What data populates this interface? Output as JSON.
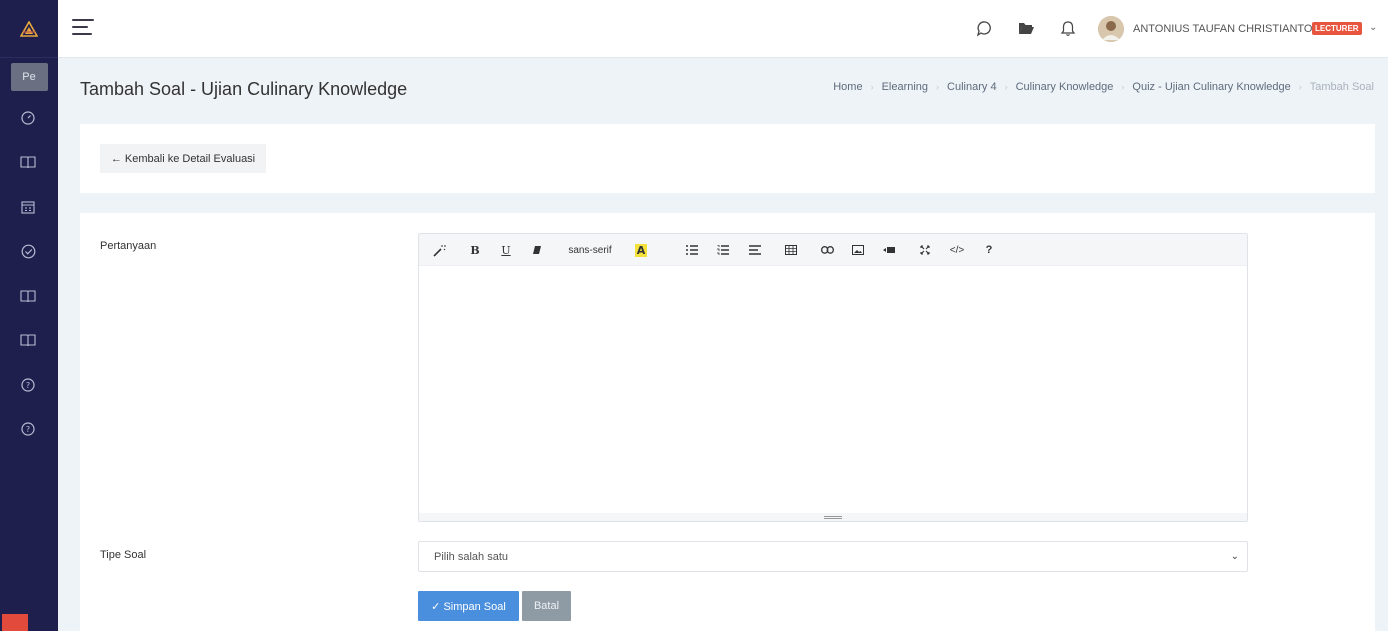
{
  "sidebar": {
    "logo_icon": "triangle-logo-icon",
    "pinned_label": "Pe",
    "items": [
      {
        "icon": "dashboard-gauge-icon"
      },
      {
        "icon": "book-icon"
      },
      {
        "icon": "calendar-icon"
      },
      {
        "icon": "check-circle-icon"
      },
      {
        "icon": "book-icon"
      },
      {
        "icon": "book-icon"
      },
      {
        "icon": "help-circle-icon"
      },
      {
        "icon": "help-circle-icon"
      }
    ],
    "colors": {
      "background": "#1f1f4e"
    }
  },
  "topbar": {
    "icons": [
      "chat-icon",
      "folder-icon",
      "bell-icon"
    ],
    "user_name": "ANTONIUS TAUFAN CHRISTIANTO",
    "role": "LECTURER"
  },
  "page": {
    "title": "Tambah Soal - Ujian Culinary Knowledge",
    "breadcrumb": [
      "Home",
      "Elearning",
      "Culinary 4",
      "Culinary Knowledge",
      "Quiz - Ujian Culinary Knowledge",
      "Tambah Soal"
    ]
  },
  "back_button": "← Kembali ke Detail Evaluasi",
  "form": {
    "question_label": "Pertanyaan",
    "editor": {
      "font_name": "sans-serif",
      "value": ""
    },
    "type_label": "Tipe Soal",
    "type_select": "Pilih salah satu",
    "save_button": "✓ Simpan Soal",
    "cancel_button": "Batal"
  },
  "colors": {
    "primary": "#4a8ede",
    "badge": "#e8553e",
    "cancel": "#8e9aa4"
  }
}
